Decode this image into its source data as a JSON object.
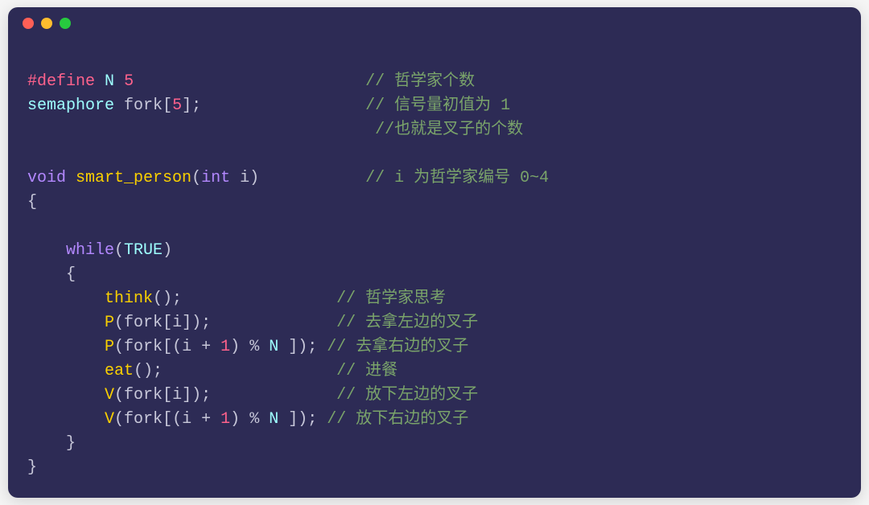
{
  "line1_define_kw": "#define",
  "line1_macro": "N",
  "line1_val": "5",
  "line1_cmt": "// 哲学家个数",
  "line2_type": "semaphore",
  "line2_id": "fork",
  "line2_idx": "5",
  "line2_cmt": "// 信号量初值为 1",
  "line3_cmt": "//也就是叉子的个数",
  "fn_ret": "void",
  "fn_name": "smart_person",
  "fn_param_type": "int",
  "fn_param_name": "i",
  "fn_cmt": "// i 为哲学家编号 0~4",
  "while_kw": "while",
  "true_const": "TRUE",
  "think_call": "think",
  "think_cmt": "// 哲学家思考",
  "p1_fn": "P",
  "fork_id": "fork",
  "i_id": "i",
  "p1_cmt": "// 去拿左边的叉子",
  "p2_expr_plus": "+",
  "one": "1",
  "mod": "%",
  "N_id": "N",
  "p2_cmt": "// 去拿右边的叉子",
  "eat_call": "eat",
  "eat_cmt": "// 进餐",
  "v_fn": "V",
  "v1_cmt": "// 放下左边的叉子",
  "v2_cmt": "// 放下右边的叉子"
}
